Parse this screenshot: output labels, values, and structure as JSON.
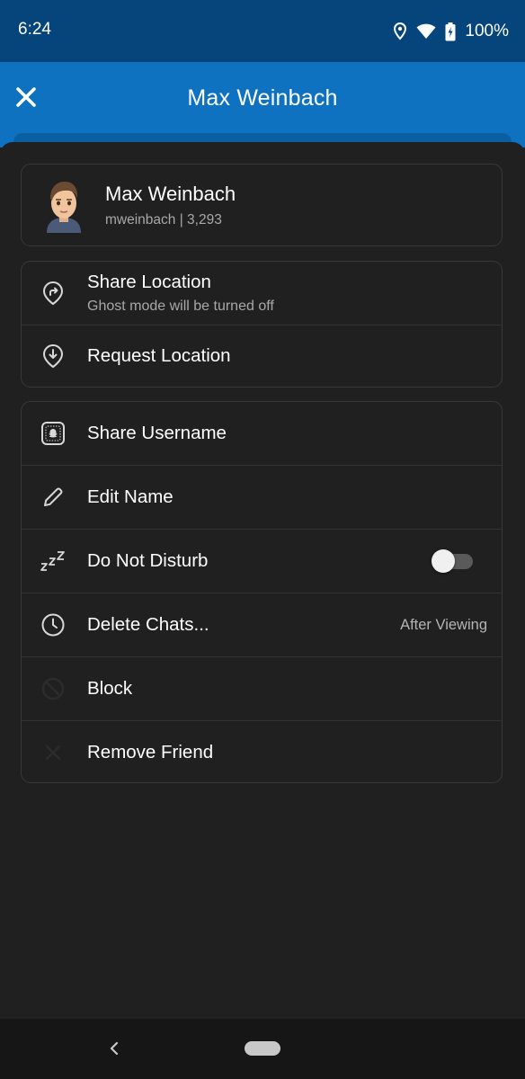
{
  "status_bar": {
    "time": "6:24",
    "battery": "100%",
    "icons": [
      "location-icon",
      "wifi-icon",
      "battery-charging-icon"
    ]
  },
  "header": {
    "title": "Max Weinbach",
    "close_icon": "close-icon",
    "background": "#0e72c0"
  },
  "profile": {
    "name": "Max Weinbach",
    "subtitle": "mweinbach | 3,293",
    "avatar_icon": "bitmoji-avatar"
  },
  "location_section": {
    "items": [
      {
        "label": "Share Location",
        "sub": "Ghost mode will be turned off",
        "icon": "share-location-icon"
      },
      {
        "label": "Request Location",
        "icon": "request-location-icon"
      }
    ]
  },
  "options_section": {
    "items": [
      {
        "label": "Share Username",
        "icon": "snapcode-icon"
      },
      {
        "label": "Edit Name",
        "icon": "pencil-icon"
      },
      {
        "label": "Do Not Disturb",
        "icon": "zzz-icon",
        "toggle": false
      },
      {
        "label": "Delete Chats...",
        "icon": "clock-icon",
        "value": "After Viewing"
      },
      {
        "label": "Block",
        "icon": "block-icon"
      },
      {
        "label": "Remove Friend",
        "icon": "x-icon"
      }
    ]
  },
  "colors": {
    "background": "#202020",
    "status_bar": "#06457b",
    "card_border": "#383838",
    "secondary_text": "#a8a8a8"
  }
}
